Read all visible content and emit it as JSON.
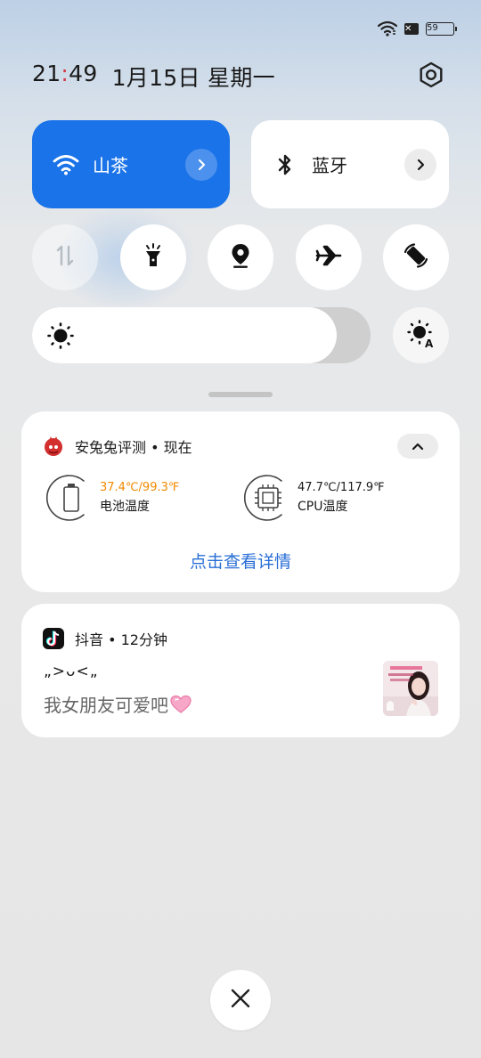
{
  "status_bar": {
    "battery_level": "59",
    "icons": [
      "wifi-icon",
      "sim-off-icon",
      "battery-icon"
    ]
  },
  "header": {
    "time_hour": "21",
    "time_colon": ":",
    "time_minutes": "49",
    "date": "1月15日 星期一"
  },
  "tiles": {
    "wifi": {
      "label": "山茶",
      "icon": "wifi-icon",
      "color": "#1a73e8",
      "active": true
    },
    "bluetooth": {
      "label": "蓝牙",
      "icon": "bluetooth-icon",
      "active": false
    }
  },
  "toggles": [
    {
      "name": "mobile-data-toggle",
      "icon": "data-arrows-icon",
      "active": false
    },
    {
      "name": "flashlight-toggle",
      "icon": "flashlight-icon",
      "active": true
    },
    {
      "name": "location-toggle",
      "icon": "location-pin-icon",
      "active": true
    },
    {
      "name": "airplane-mode-toggle",
      "icon": "airplane-icon",
      "active": true
    },
    {
      "name": "auto-rotate-toggle",
      "icon": "rotate-icon",
      "active": true
    }
  ],
  "brightness": {
    "level": 0.9,
    "auto_icon": "auto-brightness-icon"
  },
  "notifications": {
    "antutu": {
      "app_line": "安兔兔评测 • 现在",
      "battery_value": "37.4℃/99.3℉",
      "battery_label": "电池温度",
      "battery_color": "#f08a00",
      "cpu_value": "47.7℃/117.9℉",
      "cpu_label": "CPU温度",
      "action": "点击查看详情"
    },
    "douyin": {
      "app_line": "抖音 • 12分钟",
      "title": "„>ᴗ<„",
      "body": "我女朋友可爱吧"
    }
  },
  "colors": {
    "accent": "#1a73e8",
    "link": "#2a6fd6",
    "time_colon": "#d33a46"
  }
}
